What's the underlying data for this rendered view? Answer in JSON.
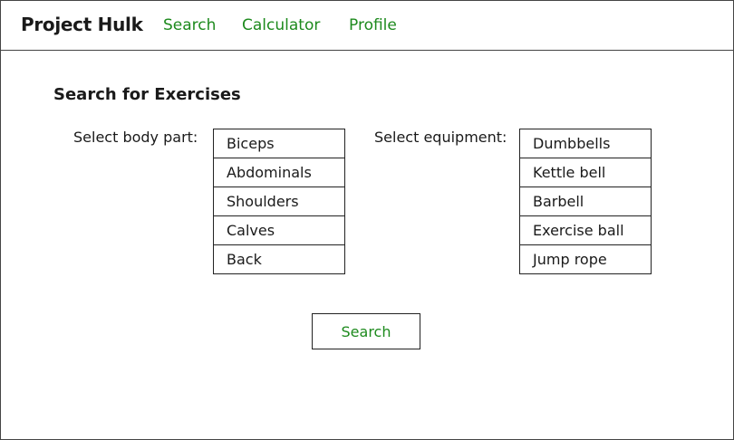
{
  "navbar": {
    "brand": "Project Hulk",
    "links": [
      "Search",
      "Calculator",
      "Profile"
    ]
  },
  "main": {
    "heading": "Search for Exercises",
    "body_part": {
      "label": "Select body part:",
      "options": [
        "Biceps",
        "Abdominals",
        "Shoulders",
        "Calves",
        "Back"
      ]
    },
    "equipment": {
      "label": "Select equipment:",
      "options": [
        "Dumbbells",
        "Kettle bell",
        "Barbell",
        "Exercise ball",
        "Jump rope"
      ]
    },
    "search_button": "Search"
  },
  "colors": {
    "accent": "#1d8a1d",
    "border": "#222222"
  }
}
